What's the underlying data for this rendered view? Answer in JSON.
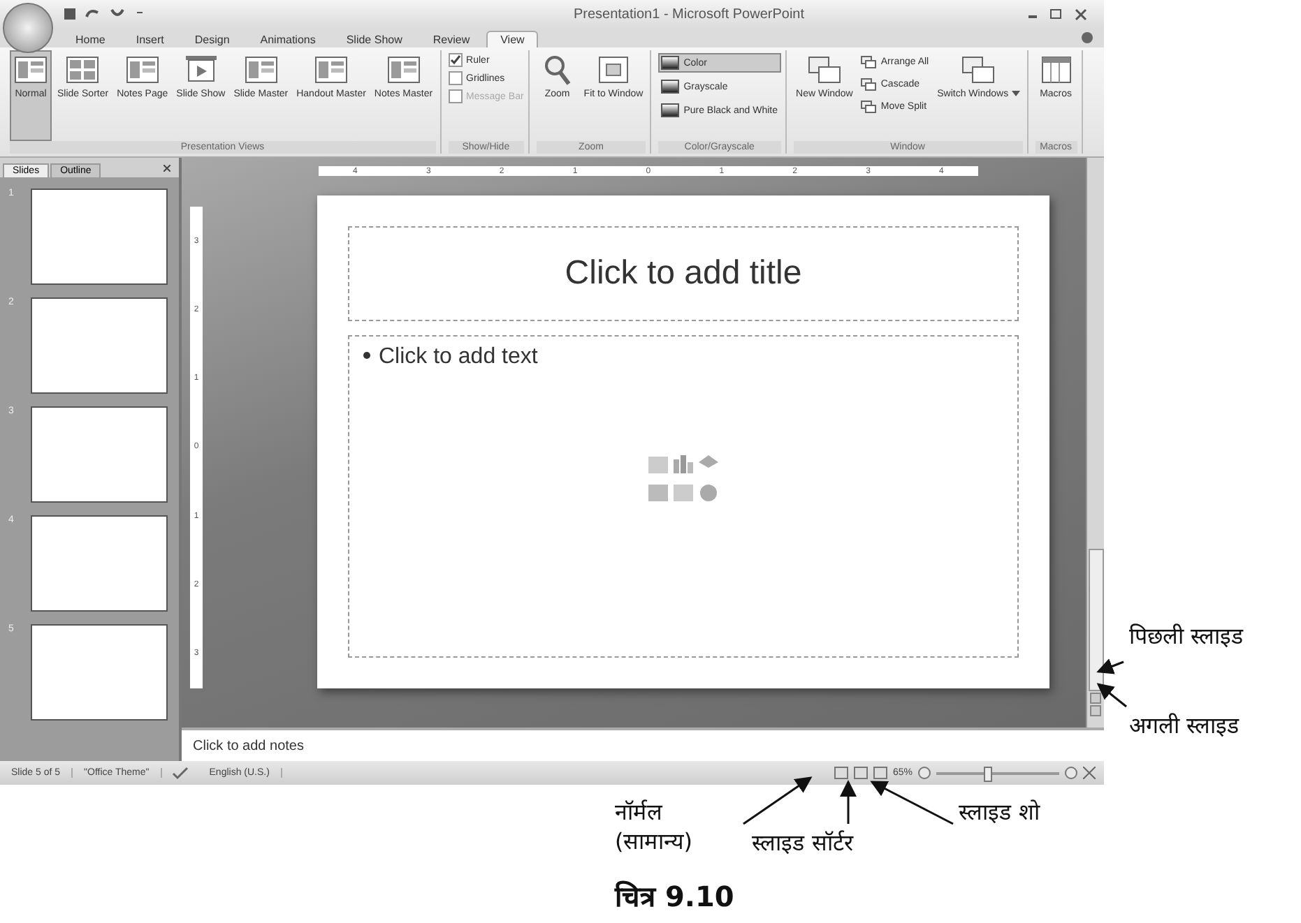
{
  "window": {
    "title": "Presentation1 - Microsoft PowerPoint"
  },
  "tabs": [
    {
      "label": "Home",
      "selected": false
    },
    {
      "label": "Insert",
      "selected": false
    },
    {
      "label": "Design",
      "selected": false
    },
    {
      "label": "Animations",
      "selected": false
    },
    {
      "label": "Slide Show",
      "selected": false
    },
    {
      "label": "Review",
      "selected": false
    },
    {
      "label": "View",
      "selected": true
    }
  ],
  "ribbon": [
    {
      "label": "Presentation Views",
      "items": [
        {
          "kind": "large",
          "label": "Normal",
          "selected": true
        },
        {
          "kind": "large",
          "label": "Slide Sorter",
          "selected": false
        },
        {
          "kind": "large",
          "label": "Notes Page",
          "selected": false
        },
        {
          "kind": "large",
          "label": "Slide Show",
          "selected": false
        },
        {
          "kind": "large",
          "label": "Slide Master",
          "selected": false
        },
        {
          "kind": "large",
          "label": "Handout Master",
          "selected": false
        },
        {
          "kind": "large",
          "label": "Notes Master",
          "selected": false
        }
      ]
    },
    {
      "label": "Show/Hide",
      "items": [
        {
          "kind": "check",
          "label": "Ruler",
          "checked": true,
          "disabled": false
        },
        {
          "kind": "check",
          "label": "Gridlines",
          "checked": false,
          "disabled": false
        },
        {
          "kind": "check",
          "label": "Message Bar",
          "checked": false,
          "disabled": true
        }
      ]
    },
    {
      "label": "Zoom",
      "items": [
        {
          "kind": "large",
          "label": "Zoom",
          "selected": false
        },
        {
          "kind": "large",
          "label": "Fit to Window",
          "selected": false
        }
      ]
    },
    {
      "label": "Color/Grayscale",
      "items": [
        {
          "kind": "swatch",
          "label": "Color",
          "selected": true
        },
        {
          "kind": "swatch",
          "label": "Grayscale",
          "selected": false
        },
        {
          "kind": "swatch",
          "label": "Pure Black and White",
          "selected": false
        }
      ]
    },
    {
      "label": "Window",
      "items": [
        {
          "kind": "large",
          "label": "New Window",
          "selected": false
        },
        {
          "kind": "small",
          "label": "Arrange All"
        },
        {
          "kind": "small",
          "label": "Cascade"
        },
        {
          "kind": "small",
          "label": "Move Split"
        },
        {
          "kind": "large",
          "label": "Switch Windows",
          "selected": false,
          "dropdown": true
        }
      ]
    },
    {
      "label": "Macros",
      "items": [
        {
          "kind": "large",
          "label": "Macros",
          "selected": false
        }
      ]
    }
  ],
  "pane_tabs": [
    {
      "label": "Slides",
      "selected": true
    },
    {
      "label": "Outline",
      "selected": false
    }
  ],
  "slides": [
    {
      "number": "1"
    },
    {
      "number": "2"
    },
    {
      "number": "3"
    },
    {
      "number": "4"
    },
    {
      "number": "5"
    }
  ],
  "ruler": {
    "horizontal": [
      "4",
      "3",
      "2",
      "1",
      "0",
      "1",
      "2",
      "3",
      "4"
    ],
    "vertical": [
      "3",
      "2",
      "1",
      "0",
      "1",
      "2",
      "3"
    ]
  },
  "slide": {
    "title_placeholder": "Click to add title",
    "body_placeholder": "Click to add text"
  },
  "notes": {
    "placeholder": "Click to add notes"
  },
  "status_bar": {
    "items": [
      "Slide 5 of 5",
      "\"Office Theme\"",
      "English (U.S.)"
    ],
    "zoom": "65%",
    "zoom_level": {
      "level": 0.4
    }
  },
  "annotations": [
    {
      "kind": "previous",
      "lines": [
        "पिछली स्लाइड"
      ]
    },
    {
      "kind": "next",
      "lines": [
        "अगली स्लाइड"
      ]
    },
    {
      "kind": "normal",
      "lines": [
        "नॉर्मल",
        "(सामान्य)"
      ]
    },
    {
      "kind": "sorter",
      "lines": [
        "स्लाइड सॉर्टर"
      ]
    },
    {
      "kind": "show",
      "lines": [
        "स्लाइड शो"
      ]
    }
  ],
  "caption": "चित्र 9.10"
}
